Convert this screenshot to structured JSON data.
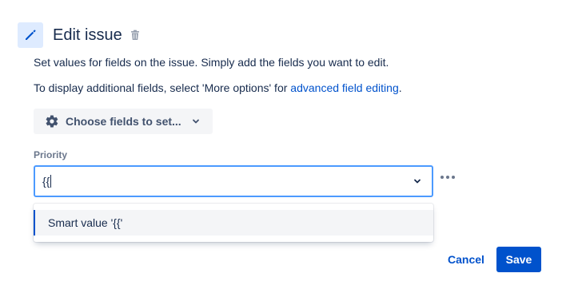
{
  "header": {
    "title": "Edit issue",
    "icon": "pencil-icon",
    "delete_icon": "trash-icon"
  },
  "description": {
    "line1": "Set values for fields on the issue. Simply add the fields you want to edit.",
    "line2_prefix": "To display additional fields, select 'More options' for ",
    "line2_link": "advanced field editing",
    "line2_suffix": "."
  },
  "choose_fields": {
    "label": "Choose fields to set...",
    "icon": "gear-icon"
  },
  "priority": {
    "label": "Priority",
    "value": "{{",
    "more_icon": "ellipsis-icon"
  },
  "dropdown": {
    "options": [
      {
        "label": "Smart value '{{'"
      }
    ]
  },
  "footer": {
    "cancel_label": "Cancel",
    "save_label": "Save"
  },
  "colors": {
    "accent": "#0052cc",
    "focus_border": "#4c9aff",
    "icon_bg": "#deebff"
  }
}
